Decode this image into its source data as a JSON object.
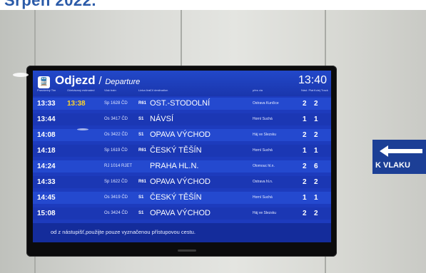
{
  "photo": {
    "headline": "Srpen 2022.",
    "wall_color": "#d9dad6",
    "frame_color": "#0b0b0c",
    "screen_color": "#1d3bbd",
    "accent_yellow": "#ffd42a"
  },
  "board": {
    "icon": "train-icon",
    "title": "Odjezd",
    "slash": "/",
    "subtitle": "Departure",
    "time": "13:40",
    "headers": {
      "planned": "Pravidelný\nTim",
      "expected": "Očekávaný\nestimated",
      "train": "Vlak\ntrain",
      "line": "Linka\nline",
      "destination": "Cíl\ndestination",
      "via": "přes\nvia",
      "platform": "Nást.\nPlat",
      "track": "Kolej\nTrack"
    },
    "rows": [
      {
        "planned": "13:33",
        "expected": "13:38",
        "train": "Sp 1628 ČD",
        "line": "R61",
        "destination": "OST.-STODOLNÍ",
        "via": "Ostrava Kunčice",
        "platform": "2",
        "track": "2"
      },
      {
        "planned": "13:44",
        "expected": "",
        "train": "Os 3417 ČD",
        "line": "S1",
        "destination": "NÁVSÍ",
        "via": "Horní Suchá",
        "platform": "1",
        "track": "1"
      },
      {
        "planned": "14:08",
        "expected": "",
        "train": "Os 3422 ČD",
        "line": "S1",
        "destination": "OPAVA VÝCHOD",
        "via": "Háj ve Slezsku",
        "platform": "2",
        "track": "2"
      },
      {
        "planned": "14:18",
        "expected": "",
        "train": "Sp 1619 ČD",
        "line": "R61",
        "destination": "ČESKÝ TĚŠÍN",
        "via": "Horní Suchá",
        "platform": "1",
        "track": "1"
      },
      {
        "planned": "14:24",
        "expected": "",
        "train": "RJ 1014 RJET",
        "line": "",
        "destination": "PRAHA HL.N.",
        "via": "Olomouc hl.n.",
        "platform": "2",
        "track": "6"
      },
      {
        "planned": "14:33",
        "expected": "",
        "train": "Sp 1622 ČD",
        "line": "R61",
        "destination": "OPAVA VÝCHOD",
        "via": "Ostrava hl.n.",
        "platform": "2",
        "track": "2"
      },
      {
        "planned": "14:45",
        "expected": "",
        "train": "Os 3419 ČD",
        "line": "S1",
        "destination": "ČESKÝ TĚŠÍN",
        "via": "Horní Suchá",
        "platform": "1",
        "track": "1"
      },
      {
        "planned": "15:08",
        "expected": "",
        "train": "Os 3424 ČD",
        "line": "S1",
        "destination": "OPAVA VÝCHOD",
        "via": "Háj ve Slezsku",
        "platform": "2",
        "track": "2"
      }
    ],
    "notice": "od z nástupišť,použijte pouze vyznačenou přístupovou cestu."
  },
  "sign": {
    "icon": "arrow-left-icon",
    "label": "K VLAKU"
  }
}
